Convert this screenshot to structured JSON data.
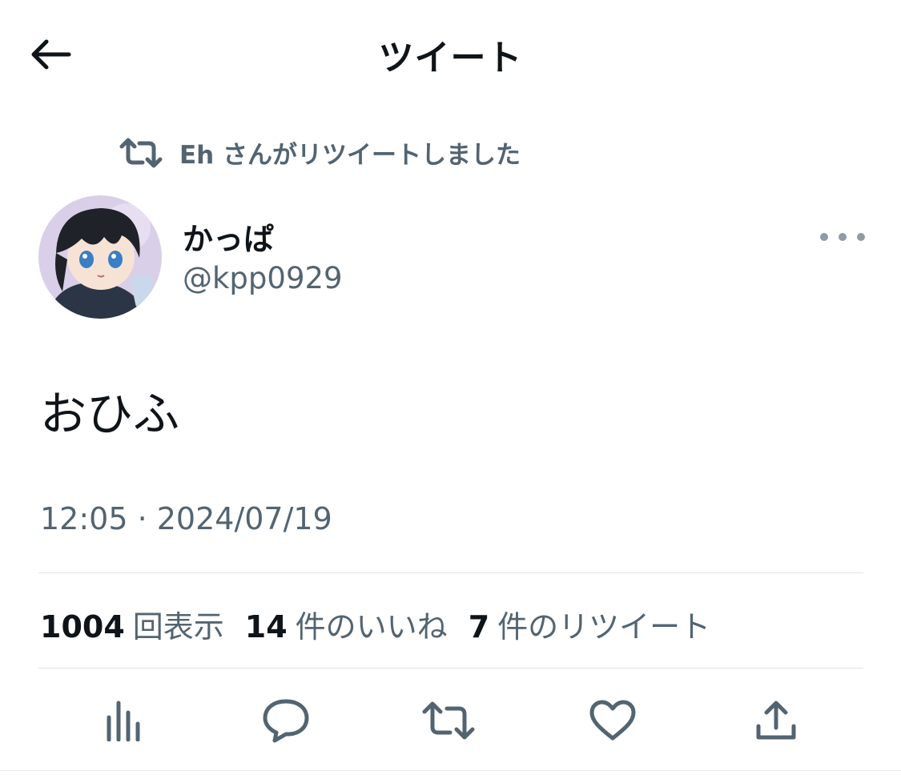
{
  "header": {
    "title": "ツイート",
    "back_icon": "arrow-left-icon"
  },
  "retweet_banner": {
    "icon": "retweet-icon",
    "text": "Eh さんがリツイートしました"
  },
  "author": {
    "display_name": "かっぱ",
    "handle": "@kpp0929",
    "avatar_label": "かっぱ"
  },
  "tweet": {
    "text": "おひふ",
    "timestamp": "12:05 · 2024/07/19"
  },
  "stats": {
    "views_count": "1004",
    "views_label": "回表示",
    "likes_count": "14",
    "likes_label": "件のいいね",
    "retweets_count": "7",
    "retweets_label": "件のリツイート"
  },
  "actions": [
    "analytics-icon",
    "reply-icon",
    "retweet-icon",
    "like-icon",
    "share-icon"
  ],
  "colors": {
    "text": "#0f1419",
    "secondary": "#536471",
    "divider": "#dfe3e6"
  }
}
